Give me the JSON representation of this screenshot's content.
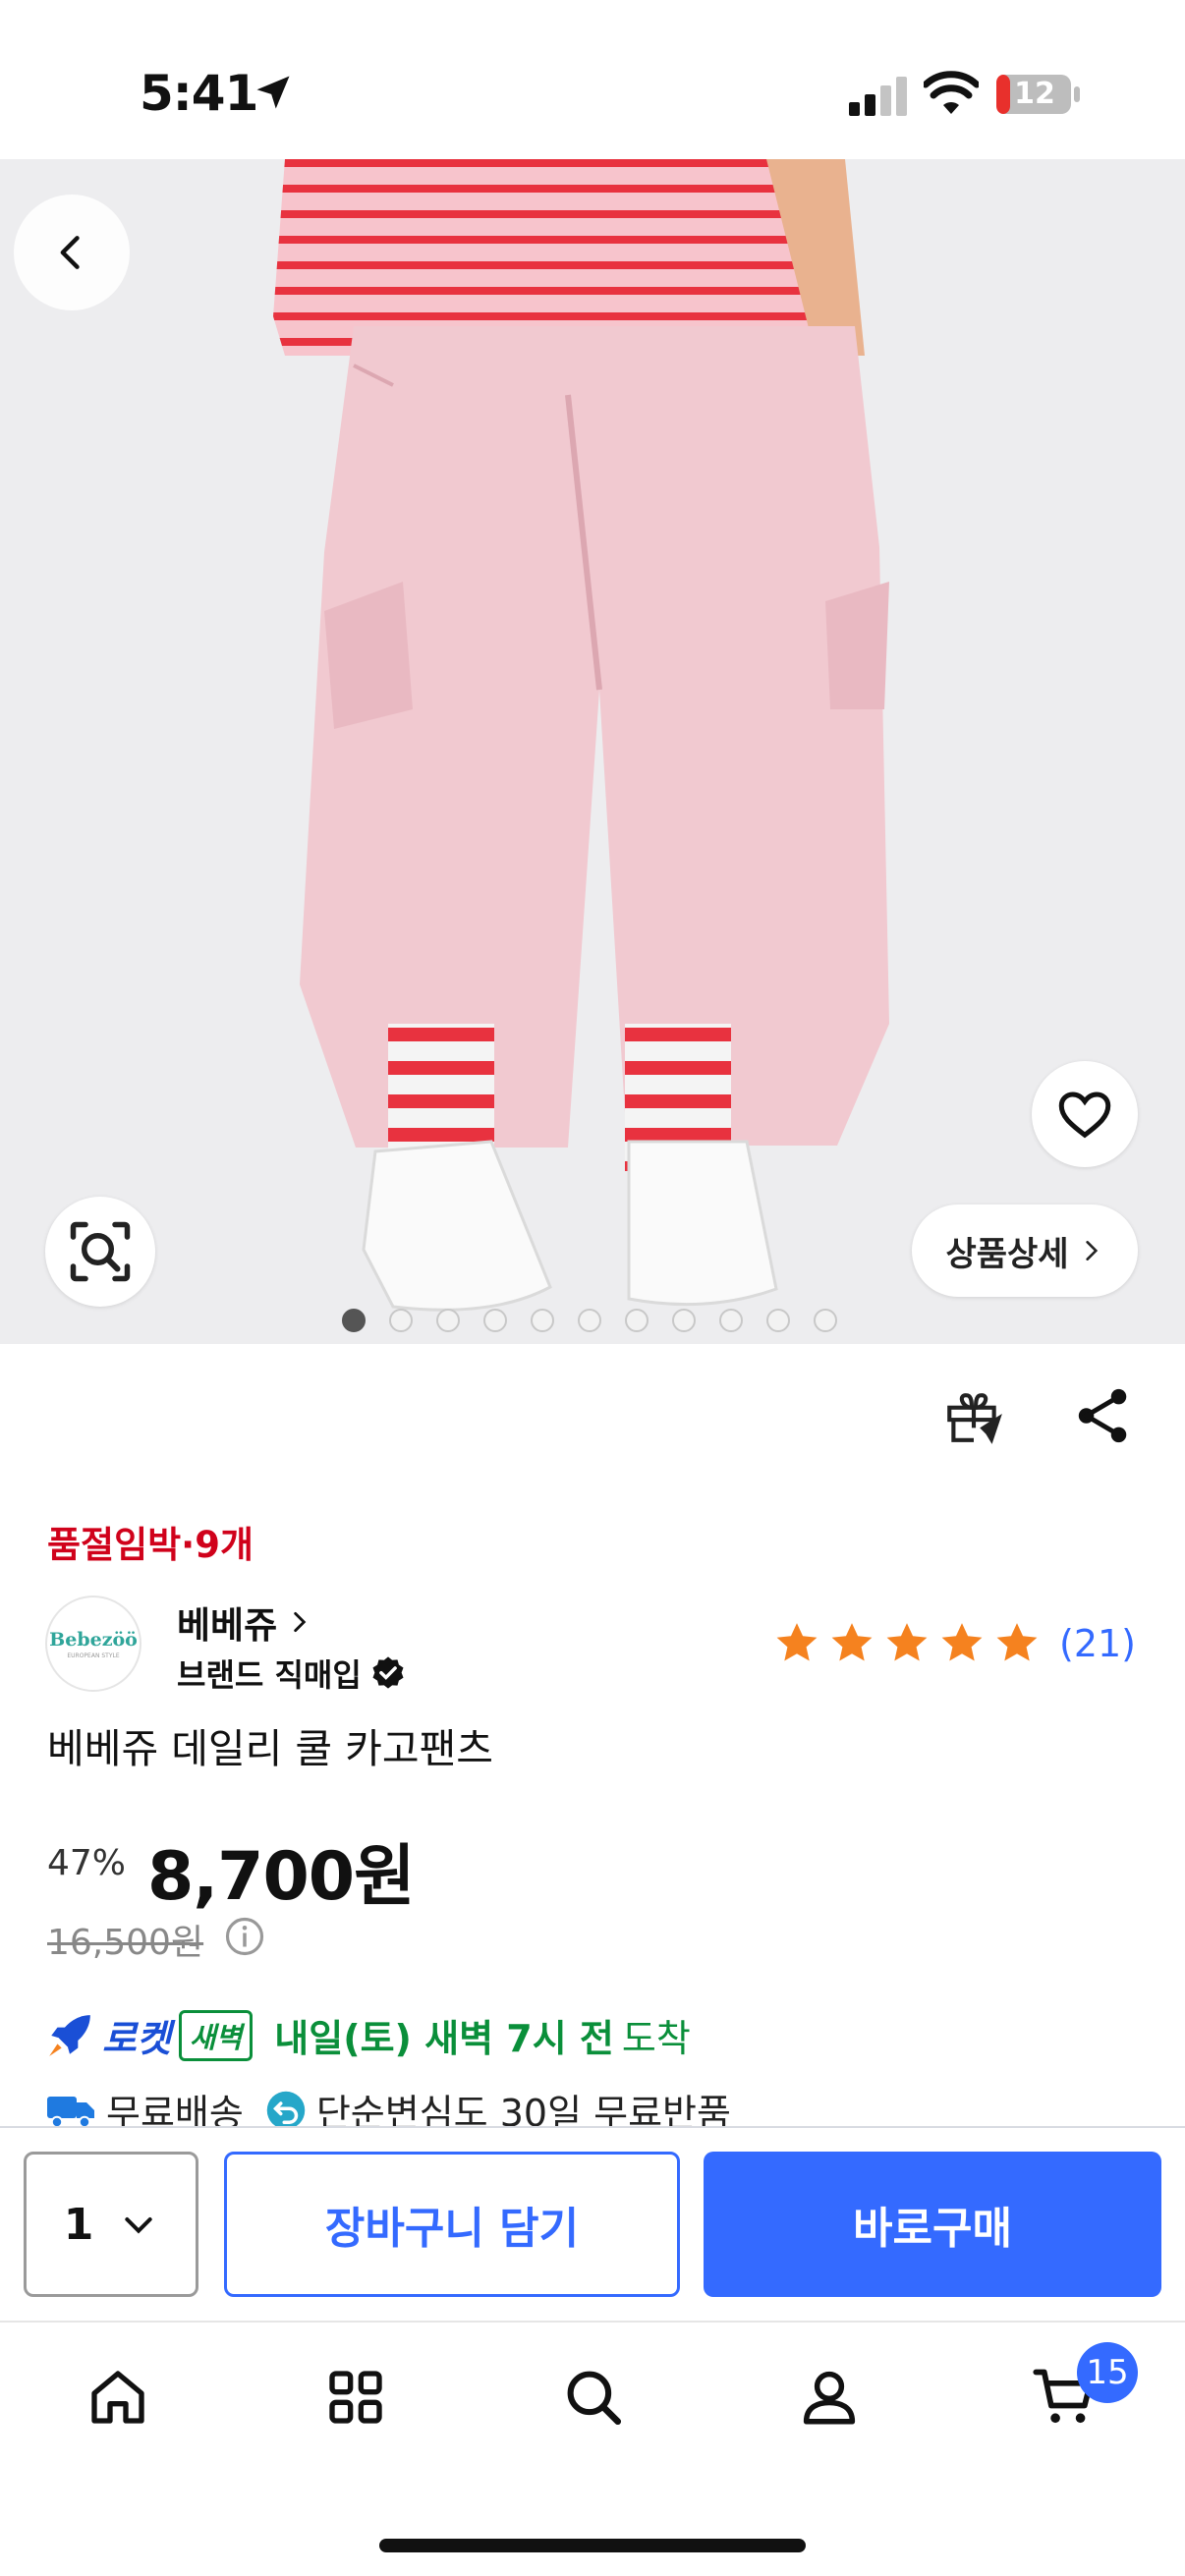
{
  "status_bar": {
    "time": "5:41",
    "battery": "12"
  },
  "product_image": {
    "detail_button_label": "상품상세",
    "slide_count": 11,
    "active_slide": 1
  },
  "product": {
    "stock_alert": "품절임박·9개",
    "brand_logo_text": "Bebezöö",
    "brand_logo_subtext": "EUROPEAN STYLE",
    "brand_name": "베베쥬",
    "brand_badge": "브랜드 직매입",
    "rating_stars": 5,
    "review_count": "(21)",
    "title": "베베쥬 데일리 쿨 카고팬츠",
    "discount": "47%",
    "price": "8,700원",
    "original_price": "16,500원"
  },
  "delivery": {
    "rocket_label": "로켓",
    "dawn_badge": "새벽",
    "arrival_highlight": "내일(토) 새벽 7시 전",
    "arrival_suffix": "도착",
    "free_shipping": "무료배송",
    "free_return": "단순변심도 30일 무료반품"
  },
  "actions": {
    "quantity": "1",
    "add_to_cart": "장바구니 담기",
    "buy_now": "바로구매"
  },
  "tab_bar": {
    "cart_count": "15"
  },
  "colors": {
    "accent": "#346aff",
    "alert_red": "#d0021b",
    "delivery_green": "#0a8f3a",
    "star": "#f5821f"
  }
}
